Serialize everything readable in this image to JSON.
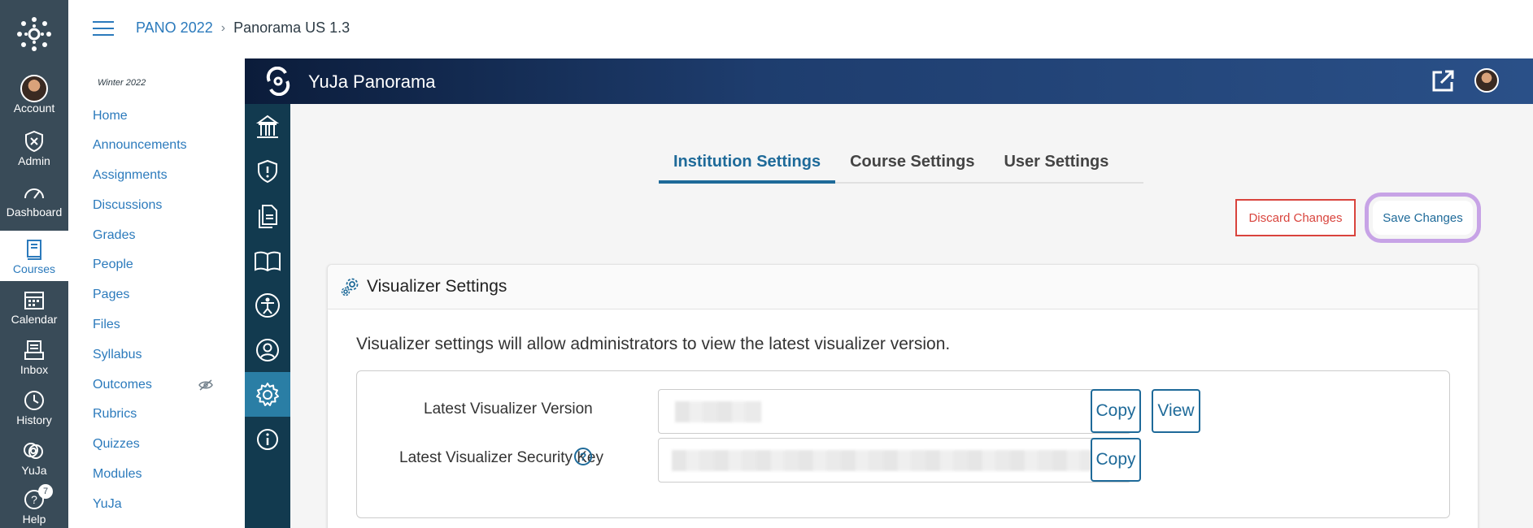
{
  "global_nav": {
    "items": [
      {
        "label": "Account",
        "icon": "avatar"
      },
      {
        "label": "Admin",
        "icon": "shield-icon"
      },
      {
        "label": "Dashboard",
        "icon": "dashboard-icon"
      },
      {
        "label": "Courses",
        "icon": "book-icon"
      },
      {
        "label": "Calendar",
        "icon": "calendar-icon"
      },
      {
        "label": "Inbox",
        "icon": "inbox-icon"
      },
      {
        "label": "History",
        "icon": "clock-icon"
      },
      {
        "label": "YuJa",
        "icon": "yuja-icon"
      },
      {
        "label": "Help",
        "icon": "help-icon",
        "badge": "7"
      }
    ]
  },
  "breadcrumb": {
    "course": "PANO 2022",
    "page": "Panorama US 1.3"
  },
  "course_nav": {
    "term": "Winter 2022",
    "items": [
      "Home",
      "Announcements",
      "Assignments",
      "Discussions",
      "Grades",
      "People",
      "Pages",
      "Files",
      "Syllabus",
      "Outcomes",
      "Rubrics",
      "Quizzes",
      "Modules",
      "YuJa"
    ]
  },
  "yuja": {
    "title": "YuJa Panorama"
  },
  "tabs": [
    "Institution Settings",
    "Course Settings",
    "User Settings"
  ],
  "actions": {
    "discard": "Discard Changes",
    "save": "Save Changes"
  },
  "visualizer": {
    "title": "Visualizer Settings",
    "description": "Visualizer settings will allow administrators to view the latest visualizer version.",
    "version_label": "Latest Visualizer Version",
    "key_label": "Latest Visualizer Security Key",
    "copy_label": "Copy",
    "view_label": "View"
  },
  "colors": {
    "accent": "#1e6a99",
    "danger": "#d9443d",
    "highlight": "#c7a3e6",
    "nav": "#394b58"
  }
}
